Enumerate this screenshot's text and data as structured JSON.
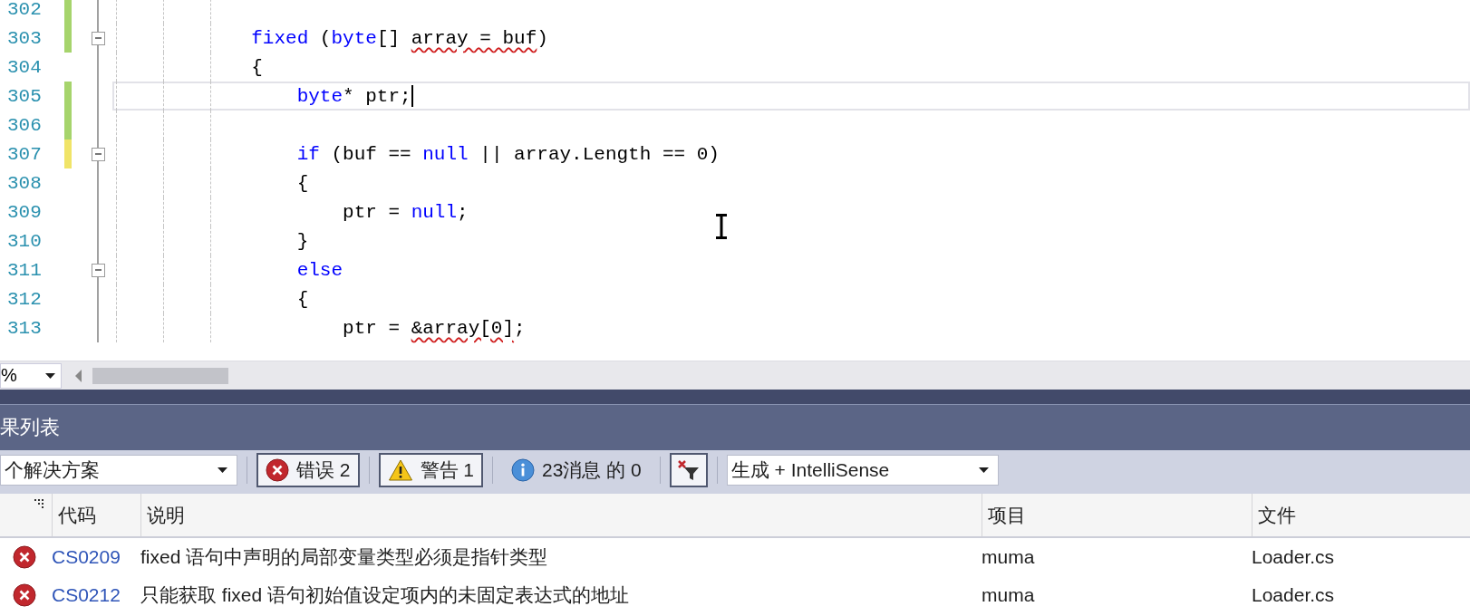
{
  "editor": {
    "lines": [
      {
        "number": "302",
        "color": "#a6d46c",
        "fold": false,
        "current": false
      },
      {
        "number": "303",
        "color": "#a6d46c",
        "fold": true,
        "current": false,
        "tokens": [
          {
            "text": "            fixed",
            "kind": "keyword"
          },
          {
            "text": " (",
            "kind": "plain"
          },
          {
            "text": "byte",
            "kind": "keyword"
          },
          {
            "text": "[] ",
            "kind": "plain"
          },
          {
            "text": "array = buf",
            "kind": "error"
          },
          {
            "text": ")",
            "kind": "plain"
          }
        ]
      },
      {
        "number": "304",
        "fold": false,
        "current": false,
        "tokens": [
          {
            "text": "            {",
            "kind": "plain"
          }
        ]
      },
      {
        "number": "305",
        "color": "#a6d46c",
        "fold": false,
        "current": true,
        "tokens": [
          {
            "text": "                byte",
            "kind": "keyword"
          },
          {
            "text": "* ptr;",
            "kind": "plain"
          }
        ]
      },
      {
        "number": "306",
        "color": "#a6d46c",
        "fold": false,
        "current": false
      },
      {
        "number": "307",
        "color": "#f0e468",
        "fold": true,
        "current": false,
        "tokens": [
          {
            "text": "                if",
            "kind": "keyword"
          },
          {
            "text": " (buf == ",
            "kind": "plain"
          },
          {
            "text": "null",
            "kind": "keyword"
          },
          {
            "text": " || array.Length == 0)",
            "kind": "plain"
          }
        ]
      },
      {
        "number": "308",
        "fold": false,
        "current": false,
        "tokens": [
          {
            "text": "                {",
            "kind": "plain"
          }
        ]
      },
      {
        "number": "309",
        "fold": false,
        "current": false,
        "tokens": [
          {
            "text": "                    ptr = ",
            "kind": "plain"
          },
          {
            "text": "null",
            "kind": "keyword"
          },
          {
            "text": ";",
            "kind": "plain"
          }
        ]
      },
      {
        "number": "310",
        "fold": false,
        "current": false,
        "tokens": [
          {
            "text": "                }",
            "kind": "plain"
          }
        ]
      },
      {
        "number": "311",
        "fold": true,
        "current": false,
        "tokens": [
          {
            "text": "                else",
            "kind": "keyword"
          }
        ]
      },
      {
        "number": "312",
        "fold": false,
        "current": false,
        "tokens": [
          {
            "text": "                {",
            "kind": "plain"
          }
        ]
      },
      {
        "number": "313",
        "fold": false,
        "current": false,
        "tokens": [
          {
            "text": "                    ptr = ",
            "kind": "plain"
          },
          {
            "text": "&array[0]",
            "kind": "error"
          },
          {
            "text": ";",
            "kind": "plain"
          }
        ]
      }
    ],
    "zoom": "%"
  },
  "error_list": {
    "title": "果列表",
    "toolbar": {
      "scope": "个解决方案",
      "filters": [
        {
          "kind": "error",
          "label": "错误 2",
          "selected": true
        },
        {
          "kind": "warning",
          "label": "警告 1",
          "selected": true
        },
        {
          "kind": "info",
          "label": "23消息 的 0",
          "selected": false
        }
      ],
      "source": "生成 + IntelliSense"
    },
    "columns": [
      "代码",
      "说明",
      "项目",
      "文件"
    ],
    "rows": [
      {
        "kind": "error",
        "code": "CS0209",
        "description": "fixed 语句中声明的局部变量类型必须是指针类型",
        "project": "muma",
        "file": "Loader.cs"
      },
      {
        "kind": "error",
        "code": "CS0212",
        "description": "只能获取 fixed 语句初始值设定项内的未固定表达式的地址",
        "project": "muma",
        "file": "Loader.cs"
      }
    ]
  }
}
